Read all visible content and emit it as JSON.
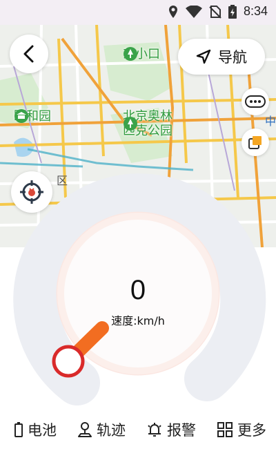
{
  "status_bar": {
    "time": "8:34",
    "icons": [
      "location-icon",
      "wifi-icon",
      "no-sim-icon",
      "battery-charging-icon"
    ]
  },
  "map": {
    "pois": [
      {
        "name": "东小口"
      },
      {
        "name": "颐和园"
      },
      {
        "name": "北京奥林\n匹克公园"
      }
    ],
    "partial_labels": [
      "中",
      "区"
    ]
  },
  "header": {
    "back_icon": "chevron-left-icon",
    "navigate_label": "导航",
    "navigate_icon": "navigation-arrow-icon"
  },
  "map_controls": {
    "more_icon": "ellipsis-pill-icon",
    "layers_icon": "layers-icon",
    "locate_icon": "target-locate-icon"
  },
  "gauge": {
    "speed_value": "0",
    "speed_label": "速度:km/h",
    "accent_color": "#f26d21",
    "knob_color": "#d92a2a"
  },
  "bottom_nav": {
    "items": [
      {
        "label": "电池",
        "icon": "battery-icon"
      },
      {
        "label": "轨迹",
        "icon": "track-pin-icon"
      },
      {
        "label": "报警",
        "icon": "alarm-bell-icon"
      },
      {
        "label": "更多",
        "icon": "grid-more-icon"
      }
    ]
  }
}
